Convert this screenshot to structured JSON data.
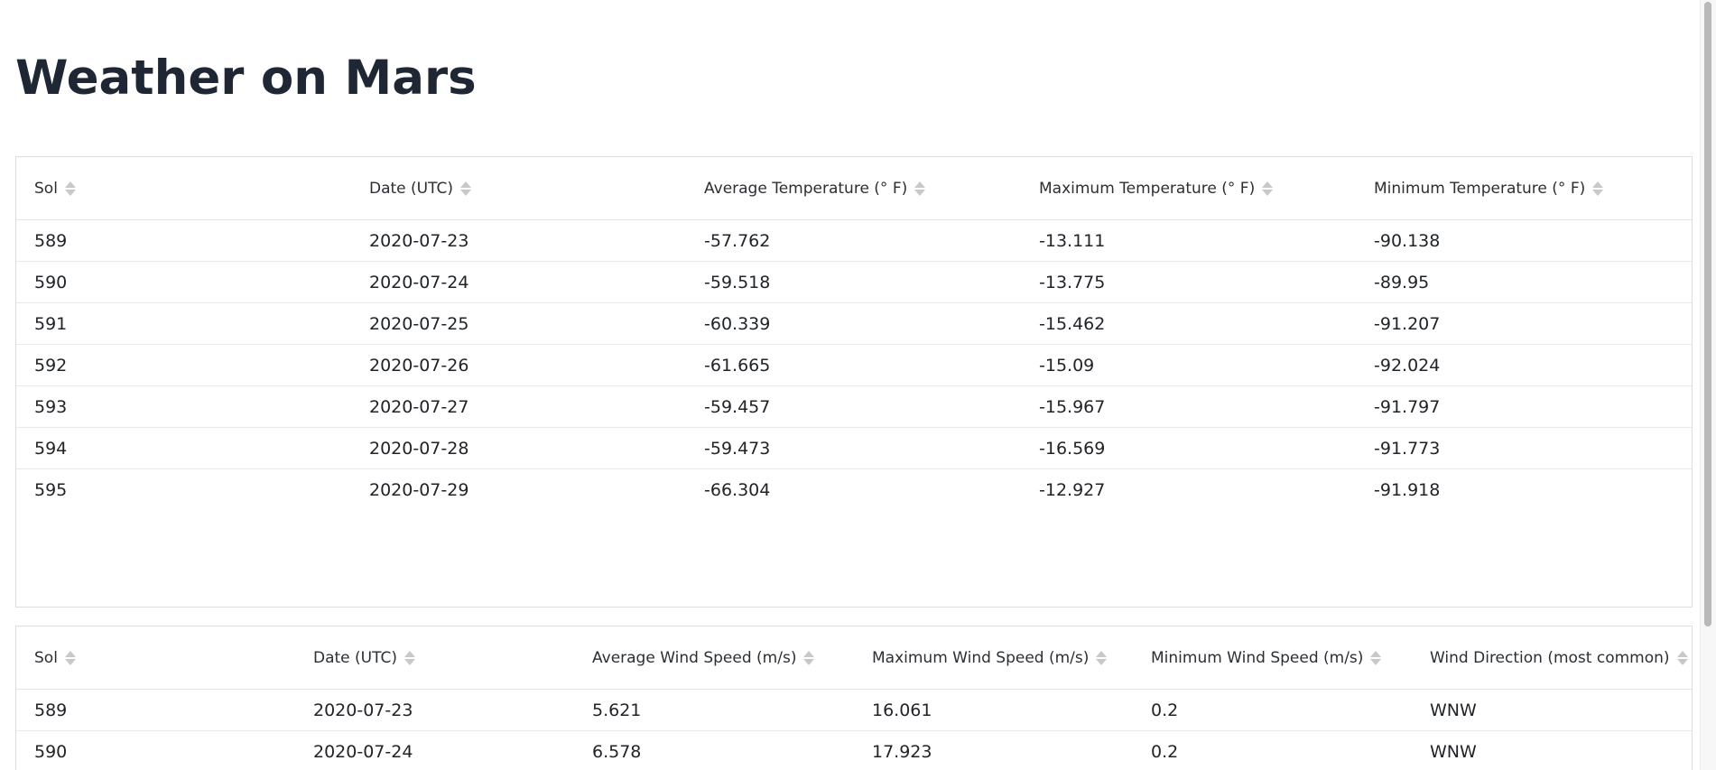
{
  "page": {
    "title": "Weather on Mars"
  },
  "temperature_table": {
    "columns": [
      "Sol",
      "Date (UTC)",
      "Average Temperature (° F)",
      "Maximum Temperature (° F)",
      "Minimum Temperature (° F)"
    ],
    "rows": [
      [
        "589",
        "2020-07-23",
        "-57.762",
        "-13.111",
        "-90.138"
      ],
      [
        "590",
        "2020-07-24",
        "-59.518",
        "-13.775",
        "-89.95"
      ],
      [
        "591",
        "2020-07-25",
        "-60.339",
        "-15.462",
        "-91.207"
      ],
      [
        "592",
        "2020-07-26",
        "-61.665",
        "-15.09",
        "-92.024"
      ],
      [
        "593",
        "2020-07-27",
        "-59.457",
        "-15.967",
        "-91.797"
      ],
      [
        "594",
        "2020-07-28",
        "-59.473",
        "-16.569",
        "-91.773"
      ],
      [
        "595",
        "2020-07-29",
        "-66.304",
        "-12.927",
        "-91.918"
      ]
    ]
  },
  "wind_table": {
    "columns": [
      "Sol",
      "Date (UTC)",
      "Average Wind Speed (m/s)",
      "Maximum Wind Speed (m/s)",
      "Minimum Wind Speed (m/s)",
      "Wind Direction (most common)"
    ],
    "rows": [
      [
        "589",
        "2020-07-23",
        "5.621",
        "16.061",
        "0.2",
        "WNW"
      ],
      [
        "590",
        "2020-07-24",
        "6.578",
        "17.923",
        "0.2",
        "WNW"
      ]
    ]
  },
  "icons": {
    "sort": "sort-icon"
  },
  "colors": {
    "text": "#1e2733",
    "border": "#dddddd",
    "sort_arrow": "#c8c8c8"
  }
}
